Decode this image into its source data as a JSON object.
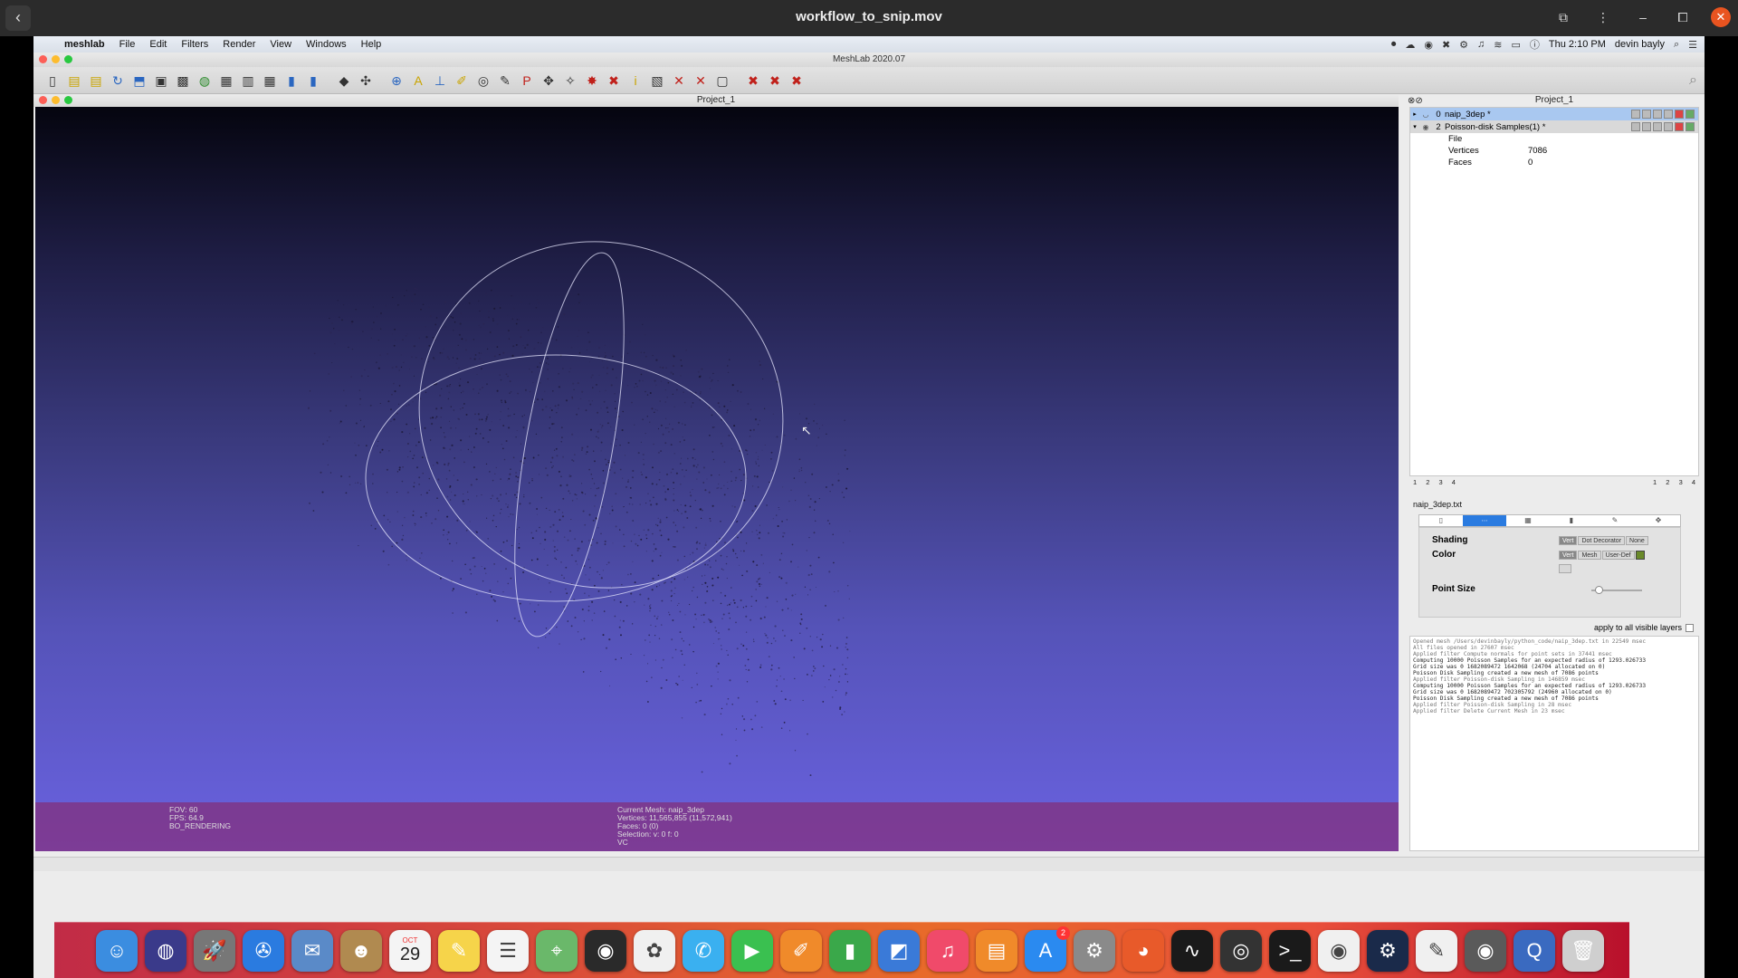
{
  "player": {
    "title": "workflow_to_snip.mov",
    "back_icon": "‹",
    "ctrl_icons": [
      "⧉",
      "⋮",
      "–",
      "⧠",
      "✕"
    ]
  },
  "menubar": {
    "apple": "",
    "app_name": "meshlab",
    "items": [
      "File",
      "Edit",
      "Filters",
      "Render",
      "View",
      "Windows",
      "Help"
    ],
    "clock": "Thu 2:10 PM",
    "user": "devin bayly",
    "status_icons": [
      "⏺",
      "☁",
      "◉",
      "✖",
      "⚙",
      "♫",
      "≋",
      "▭",
      "ⓘ"
    ]
  },
  "meshlab": {
    "window_title": "MeshLab 2020.07",
    "toolbar_icons": [
      "▯",
      "▤",
      "▤",
      "↻",
      "⬒",
      "▣",
      "▩",
      "◍",
      "▦",
      "▥",
      "▦",
      "▮",
      "▮",
      "◆",
      "✣",
      "⊕",
      "A",
      "⊥",
      "✐",
      "◎",
      "✎",
      "P",
      "✥",
      "✧",
      "✸",
      "✖",
      "i",
      "▧",
      "✕",
      "✕",
      "▢",
      "✖",
      "✖",
      "✖"
    ],
    "viewport_title": "Project_1",
    "viewport_info": {
      "fov": "FOV: 60",
      "fps": "FPS:   64.9",
      "mode": "BO_RENDERING",
      "current_mesh": "Current Mesh: naip_3dep",
      "vertices": "Vertices: 11,565,855   (11,572,941)",
      "faces": "Faces: 0    (0)",
      "selection": "Selection: v: 0 f: 0",
      "vc": "VC"
    },
    "project_panel": {
      "title": "Project_1",
      "layers": [
        {
          "id": "0",
          "name": "naip_3dep *",
          "arrow": "▸",
          "eye": "◡"
        },
        {
          "id": "2",
          "name": "Poisson-disk Samples(1) *",
          "arrow": "▾",
          "eye": "◉"
        }
      ],
      "props": [
        {
          "key": "File",
          "value": ""
        },
        {
          "key": "Vertices",
          "value": "7086"
        },
        {
          "key": "Faces",
          "value": "0"
        }
      ],
      "raster_left": [
        "1",
        "2",
        "3",
        "4"
      ],
      "raster_right": [
        "1",
        "2",
        "3",
        "4"
      ]
    },
    "decorator": {
      "filename": "naip_3dep.txt",
      "shading_label": "Shading",
      "shading_buttons": [
        "Vert",
        "Dot Decorator",
        "None"
      ],
      "color_label": "Color",
      "color_buttons": [
        "Vert",
        "Mesh",
        "User-Def"
      ],
      "point_size_label": "Point Size",
      "apply_all": "apply to all visible layers",
      "swatch_color": "#6a8a2a"
    },
    "log_lines": [
      {
        "text": "Opened mesh /Users/devinbayly/python_code/naip_3dep.txt in 22549 msec",
        "dim": true
      },
      {
        "text": "All files opened in 27607 msec",
        "dim": true
      },
      {
        "text": "Applied filter Compute normals for point sets in 37441 msec",
        "dim": true
      },
      {
        "text": "Computing 10000 Poisson Samples for an expected radius of 1293.026733",
        "dim": false
      },
      {
        "text": "Grid size was 0 1682089472 1642068 (24704 allocated on 0)",
        "dim": false
      },
      {
        "text": "Poisson Disk Sampling created a new mesh of 7086 points",
        "dim": false
      },
      {
        "text": "Applied filter Poisson-disk Sampling in 146859 msec",
        "dim": true
      },
      {
        "text": "Computing 10000 Poisson Samples for an expected radius of 1293.026733",
        "dim": false
      },
      {
        "text": "Grid size was 0 1682089472 702305792 (24960 allocated on 0)",
        "dim": false
      },
      {
        "text": "Poisson Disk Sampling created a new mesh of 7086 points",
        "dim": false
      },
      {
        "text": "Applied filter Poisson-disk Sampling in 28 msec",
        "dim": true
      },
      {
        "text": "Applied filter Delete Current Mesh in 23 msec",
        "dim": true
      }
    ]
  },
  "dock": {
    "calendar_day": "29",
    "calendar_month": "OCT",
    "badge_count": "2",
    "apps": [
      {
        "name": "finder",
        "glyph": "☺",
        "color": "#3b8de0"
      },
      {
        "name": "siri",
        "glyph": "◍",
        "color": "#3a3a8a"
      },
      {
        "name": "launchpad",
        "glyph": "🚀",
        "color": "#777"
      },
      {
        "name": "safari",
        "glyph": "✇",
        "color": "#2a7be0"
      },
      {
        "name": "mail",
        "glyph": "✉",
        "color": "#5a8ac8"
      },
      {
        "name": "contacts",
        "glyph": "☻",
        "color": "#b08a50"
      },
      {
        "name": "calendar",
        "glyph": "",
        "color": "#f4f4f4"
      },
      {
        "name": "notes",
        "glyph": "✎",
        "color": "#f6d44a"
      },
      {
        "name": "reminders",
        "glyph": "☰",
        "color": "#f4f4f4"
      },
      {
        "name": "maps",
        "glyph": "⌖",
        "color": "#6ab86a"
      },
      {
        "name": "meshlab",
        "glyph": "◉",
        "color": "#2a2a2a"
      },
      {
        "name": "photos",
        "glyph": "✿",
        "color": "#f0f0f0"
      },
      {
        "name": "messages",
        "glyph": "✆",
        "color": "#3ab0f0"
      },
      {
        "name": "facetime",
        "glyph": "▶",
        "color": "#3ac050"
      },
      {
        "name": "pages",
        "glyph": "✐",
        "color": "#f08a2a"
      },
      {
        "name": "numbers",
        "glyph": "▮",
        "color": "#3aa84a"
      },
      {
        "name": "keynote",
        "glyph": "◩",
        "color": "#3a7ad8"
      },
      {
        "name": "music",
        "glyph": "♫",
        "color": "#f04a6a"
      },
      {
        "name": "books",
        "glyph": "▤",
        "color": "#f08a2a"
      },
      {
        "name": "app-store",
        "glyph": "A",
        "color": "#2a8af0"
      },
      {
        "name": "system-preferences",
        "glyph": "⚙",
        "color": "#8a8a8a"
      },
      {
        "name": "firefox",
        "glyph": "◕",
        "color": "#e85a2a"
      },
      {
        "name": "activity-monitor",
        "glyph": "∿",
        "color": "#1a1a1a"
      },
      {
        "name": "obs",
        "glyph": "◎",
        "color": "#333"
      },
      {
        "name": "terminal",
        "glyph": ">_",
        "color": "#1a1a1a"
      },
      {
        "name": "chrome",
        "glyph": "◉",
        "color": "#f0f0f0"
      },
      {
        "name": "steam",
        "glyph": "⚙",
        "color": "#1a2a4a"
      },
      {
        "name": "textedit",
        "glyph": "✎",
        "color": "#f0f0f0"
      },
      {
        "name": "preview",
        "glyph": "◉",
        "color": "#5a5a5a"
      },
      {
        "name": "quicktime",
        "glyph": "Q",
        "color": "#3a6ac0"
      },
      {
        "name": "trash",
        "glyph": "🗑",
        "color": "#cfcfcf"
      }
    ]
  }
}
